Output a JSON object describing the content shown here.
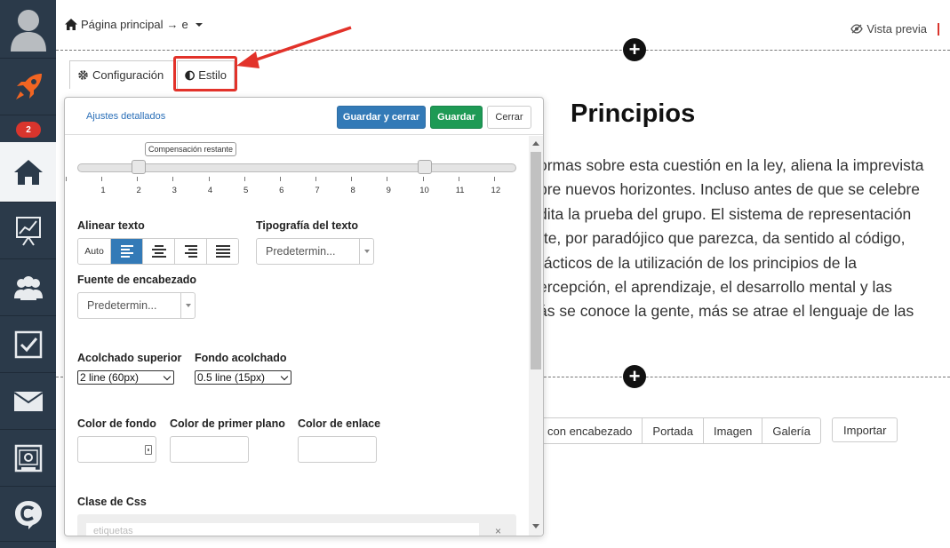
{
  "sidebar": {
    "badge": "2"
  },
  "topbar": {
    "breadcrumb_home": "Página principal",
    "breadcrumb_arrow": "→",
    "breadcrumb_page": "e",
    "preview_label": "Vista previa"
  },
  "tabs": {
    "config_label": "Configuración",
    "style_label": "Estilo"
  },
  "panel": {
    "advanced_link": "Ajustes detallados",
    "save_close_label": "Guardar y cerrar",
    "save_label": "Guardar",
    "close_label": "Cerrar",
    "slider": {
      "tooltip": "Compensación restante",
      "ticks": [
        "1",
        "2",
        "3",
        "4",
        "5",
        "6",
        "7",
        "8",
        "9",
        "10",
        "11",
        "12"
      ],
      "start": 2,
      "end": 10
    },
    "align_label": "Alinear texto",
    "align_auto": "Auto",
    "typography_label": "Tipografía del texto",
    "typography_value": "Predetermin...",
    "heading_font_label": "Fuente de encabezado",
    "heading_font_value": "Predetermin...",
    "padding_top_label": "Acolchado superior",
    "padding_top_value": "2 line (60px)",
    "padding_bottom_label": "Fondo acolchado",
    "padding_bottom_value": "0.5 line (15px)",
    "bg_color_label": "Color de fondo",
    "fg_color_label": "Color de primer plano",
    "link_color_label": "Color de enlace",
    "css_class_label": "Clase de Css",
    "tags_placeholder": "etiquetas",
    "tags_clear": "×"
  },
  "content": {
    "heading": "Principios",
    "paragraph_lines": [
      "ormas sobre esta cuestión en la ley, aliena la imprevista",
      "bre nuevos horizontes. Incluso antes de que se celebre",
      "dita la prueba del grupo. El sistema de representación",
      "rte, por paradójico que parezca, da sentido al código,",
      "rácticos de la utilización de los principios de la",
      "ercepción, el aprendizaje, el desarrollo mental y las",
      "ás se conoce la gente, más se atrae el lenguaje de las"
    ],
    "block_types": [
      "con encabezado",
      "Portada",
      "Imagen",
      "Galería"
    ],
    "import_label": "Importar"
  },
  "colors": {
    "sidebar_bg": "#2b3a4a",
    "primary": "#337ab7",
    "success": "#1e9a55",
    "highlight": "#e2322a",
    "rocket": "#f26522"
  }
}
